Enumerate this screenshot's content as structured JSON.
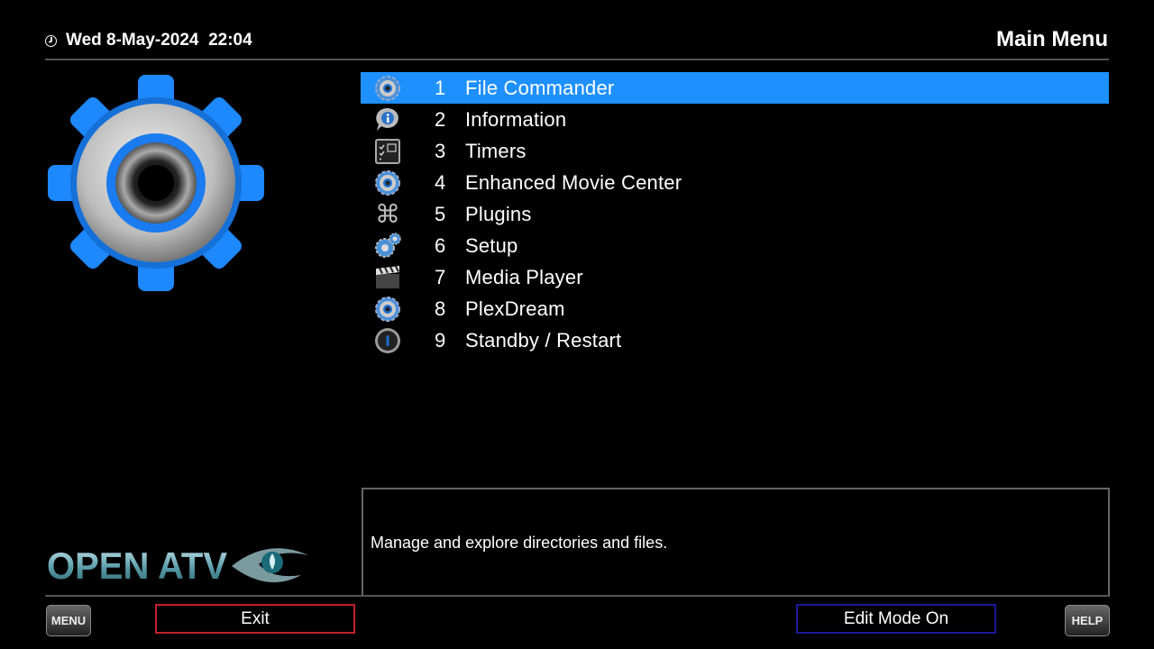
{
  "header": {
    "date": "Wed 8-May-2024",
    "time": "22:04",
    "title": "Main Menu"
  },
  "menu": {
    "selected_index": 0,
    "items": [
      {
        "num": "1",
        "label": "File Commander",
        "icon": "gear-small-icon"
      },
      {
        "num": "2",
        "label": "Information",
        "icon": "info-icon"
      },
      {
        "num": "3",
        "label": "Timers",
        "icon": "timer-checklist-icon"
      },
      {
        "num": "4",
        "label": "Enhanced Movie Center",
        "icon": "gear-small-icon"
      },
      {
        "num": "5",
        "label": "Plugins",
        "icon": "command-key-icon"
      },
      {
        "num": "6",
        "label": "Setup",
        "icon": "gears-icon"
      },
      {
        "num": "7",
        "label": "Media Player",
        "icon": "clapperboard-icon"
      },
      {
        "num": "8",
        "label": "PlexDream",
        "icon": "gear-small-icon"
      },
      {
        "num": "9",
        "label": "Standby / Restart",
        "icon": "power-icon"
      }
    ]
  },
  "description": "Manage and explore directories and files.",
  "buttons": {
    "menu_key": "MENU",
    "exit": "Exit",
    "edit_mode": "Edit Mode On",
    "help_key": "HELP"
  },
  "logo": {
    "text": "OPEN ATV"
  },
  "colors": {
    "selection": "#1e90ff",
    "exit_border": "#c0202a",
    "edit_border": "#1a1a9a"
  }
}
